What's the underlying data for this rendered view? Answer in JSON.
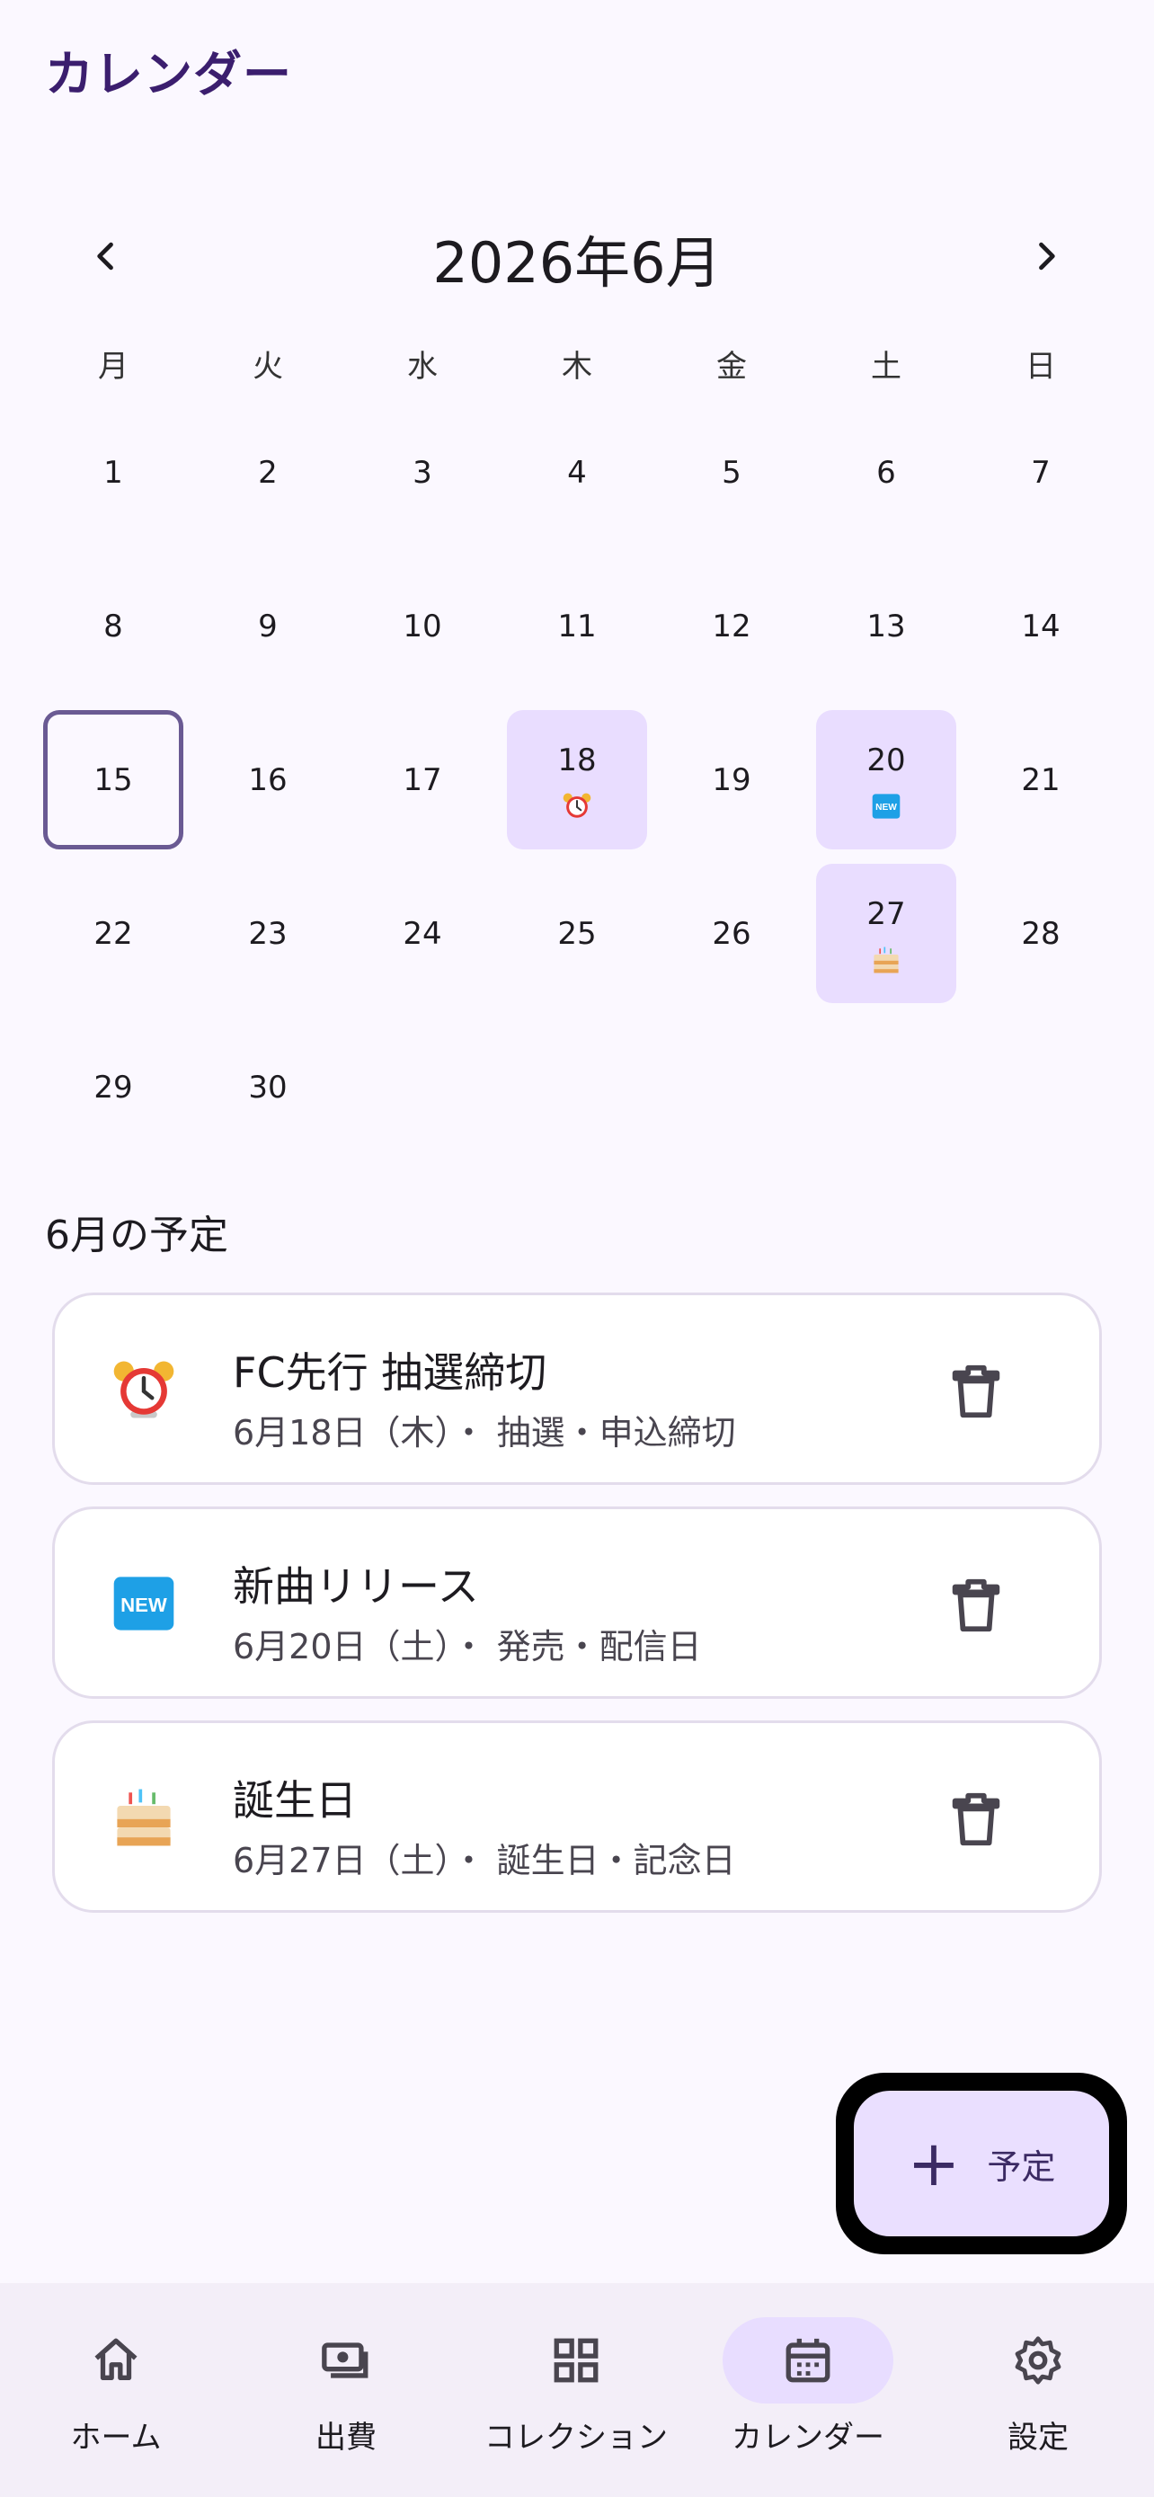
{
  "app_title": "カレンダー",
  "calendar": {
    "month_label": "2026年6月",
    "prev_icon": "chevron-left-icon",
    "next_icon": "chevron-right-icon",
    "weekdays": [
      "月",
      "火",
      "水",
      "木",
      "金",
      "土",
      "日"
    ],
    "weeks": [
      [
        "1",
        "2",
        "3",
        "4",
        "5",
        "6",
        "7"
      ],
      [
        "8",
        "9",
        "10",
        "11",
        "12",
        "13",
        "14"
      ],
      [
        "15",
        "16",
        "17",
        "18",
        "19",
        "20",
        "21"
      ],
      [
        "22",
        "23",
        "24",
        "25",
        "26",
        "27",
        "28"
      ],
      [
        "29",
        "30",
        "",
        "",
        "",
        "",
        ""
      ]
    ],
    "today": "15",
    "event_days": {
      "18": "alarm-clock-icon",
      "20": "new-badge-icon",
      "27": "birthday-cake-icon"
    }
  },
  "events_section": {
    "title": "6月の予定",
    "items": [
      {
        "icon": "alarm-clock-icon",
        "title": "FC先行 抽選締切",
        "subtitle": "6月18日（木）・ 抽選・申込締切"
      },
      {
        "icon": "new-badge-icon",
        "title": "新曲リリース",
        "subtitle": "6月20日（土）・ 発売・配信日"
      },
      {
        "icon": "birthday-cake-icon",
        "title": "誕生日",
        "subtitle": "6月27日（土）・ 誕生日・記念日"
      }
    ]
  },
  "fab": {
    "icon": "plus-icon",
    "label": "予定"
  },
  "bottom_nav": {
    "items": [
      {
        "label": "ホーム",
        "icon": "home-icon",
        "active": false
      },
      {
        "label": "出費",
        "icon": "money-icon",
        "active": false
      },
      {
        "label": "コレクション",
        "icon": "grid-icon",
        "active": false
      },
      {
        "label": "カレンダー",
        "icon": "calendar-icon",
        "active": true
      },
      {
        "label": "設定",
        "icon": "gear-icon",
        "active": false
      }
    ]
  },
  "colors": {
    "accent": "#e9ddff",
    "title": "#3b1e6e",
    "today_border": "#6a5a93",
    "background": "#fbf8ff"
  }
}
